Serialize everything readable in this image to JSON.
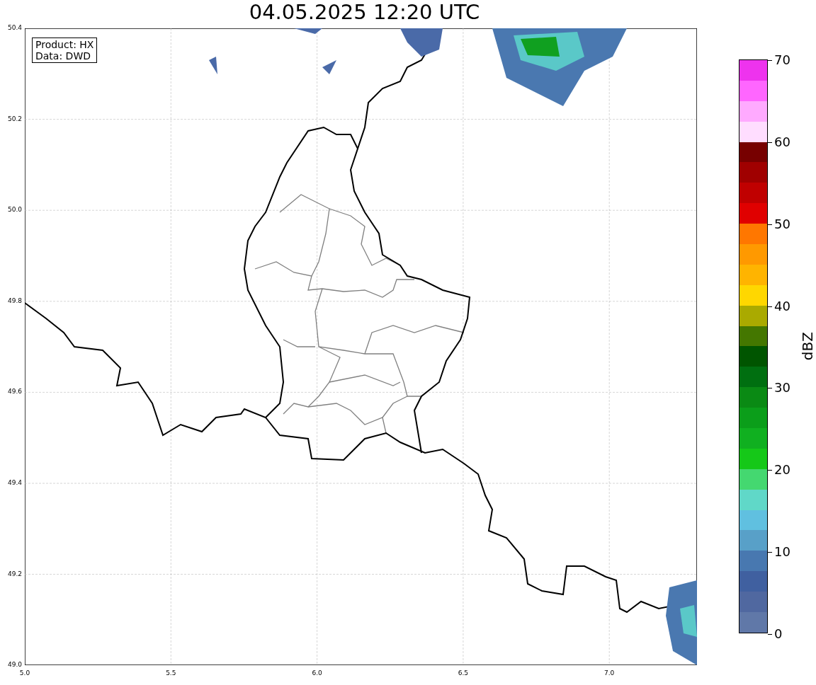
{
  "title": "04.05.2025 12:20 UTC",
  "info_box": [
    "Product: HX",
    "Data: DWD"
  ],
  "x_axis": {
    "ticks": [
      "5.0",
      "5.5",
      "6.0",
      "6.5",
      "7.0"
    ]
  },
  "y_axis": {
    "ticks": [
      "50.4",
      "50.2",
      "50.0",
      "49.8",
      "49.6",
      "49.4",
      "49.2",
      "49.0"
    ]
  },
  "colorbar": {
    "label": "dBZ",
    "ticks": [
      "70",
      "60",
      "50",
      "40",
      "30",
      "20",
      "10",
      "0"
    ],
    "segments": [
      {
        "color": "#ee33ee"
      },
      {
        "color": "#ff66ff"
      },
      {
        "color": "#ffaaff"
      },
      {
        "color": "#ffddff"
      },
      {
        "color": "#770000"
      },
      {
        "color": "#a00000"
      },
      {
        "color": "#c00000"
      },
      {
        "color": "#e00000"
      },
      {
        "color": "#ff7700"
      },
      {
        "color": "#ff9900"
      },
      {
        "color": "#ffb400"
      },
      {
        "color": "#ffd700"
      },
      {
        "color": "#aaaa00"
      },
      {
        "color": "#447700"
      },
      {
        "color": "#005500"
      },
      {
        "color": "#006f10"
      },
      {
        "color": "#0a8a14"
      },
      {
        "color": "#0b9e1a"
      },
      {
        "color": "#10b020"
      },
      {
        "color": "#15c818"
      },
      {
        "color": "#44d870"
      },
      {
        "color": "#60d8c8"
      },
      {
        "color": "#60c0e0"
      },
      {
        "color": "#58a0c8"
      },
      {
        "color": "#4878b0"
      },
      {
        "color": "#4060a0"
      },
      {
        "color": "#5068a0"
      },
      {
        "color": "#6078a8"
      }
    ]
  }
}
